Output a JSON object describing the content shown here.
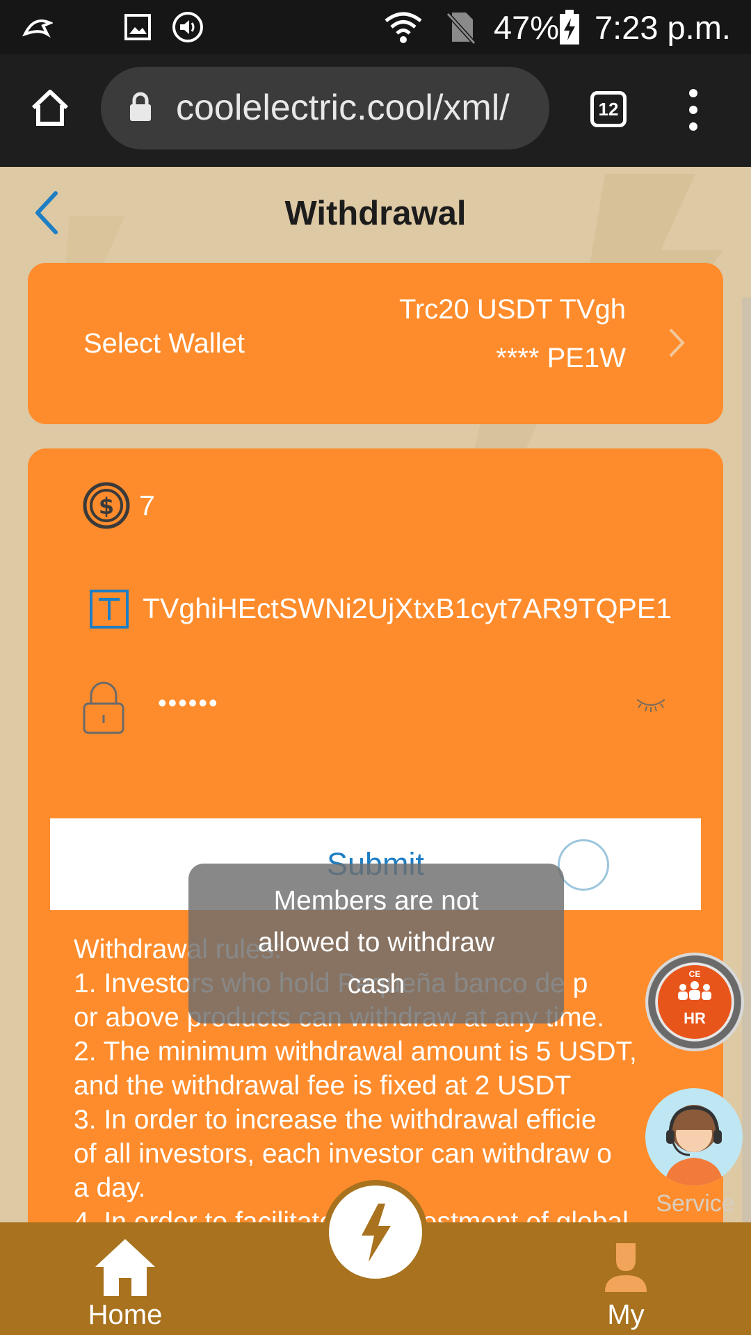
{
  "status_bar": {
    "battery": "47%",
    "time": "7:23 p.m.",
    "icons": [
      "app-notification-icon",
      "image-icon",
      "volume-icon",
      "wifi-icon",
      "no-sim-icon",
      "battery-charging-icon"
    ]
  },
  "browser": {
    "url": "coolelectric.cool/xml/",
    "tab_count": "12"
  },
  "page": {
    "title": "Withdrawal"
  },
  "wallet": {
    "label": "Select Wallet",
    "value_line1": "Trc20 USDT TVgh",
    "value_line2": "**** PE1W"
  },
  "form": {
    "amount": "7",
    "address": "TVghiHEctSWNi2UjXtxB1cyt7AR9TQPE1",
    "password_mask": "••••••",
    "submit_label": "Submit"
  },
  "toast": {
    "line1": "Members are not",
    "line2": "allowed to withdraw",
    "line3": "cash"
  },
  "rules": {
    "heading": "Withdrawal rules:",
    "line1": "1. Investors who hold Pequeña banco de p",
    "line2": "or above products can withdraw at any time.",
    "line3": "2. The minimum withdrawal amount is 5 USDT,",
    "line4": "and the withdrawal fee is fixed at 2 USDT",
    "line5": "3. In order to increase the withdrawal efficie",
    "line6": "of all investors, each investor can withdraw o",
    "line7": "a day.",
    "line8": "4. In order to facilitate the investment of global"
  },
  "floating": {
    "hr_label": "HR",
    "hr_brand": "CE",
    "service_label": "Service"
  },
  "bottom_nav": {
    "home_label": "Home",
    "my_label": "My"
  },
  "colors": {
    "card_orange": "#ff8c2c",
    "nav_brown": "#a8721e",
    "page_bg": "#ddc9a4",
    "submit_text": "#1e7ec4"
  }
}
